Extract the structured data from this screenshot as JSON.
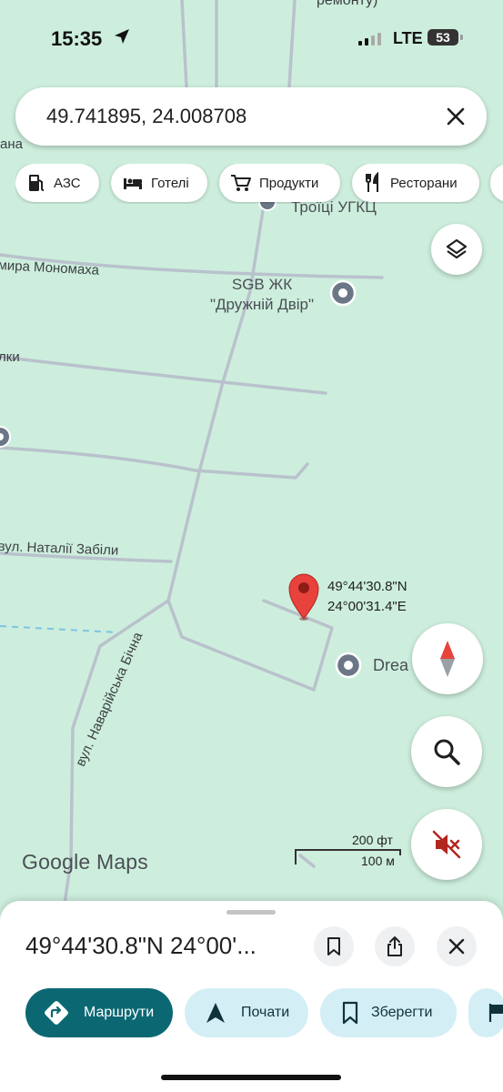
{
  "status_bar": {
    "time": "15:35",
    "network": "LTE",
    "battery": "53"
  },
  "search": {
    "query": "49.741895, 24.008708"
  },
  "chips": [
    {
      "label": "АЗС",
      "icon": "gas-station-icon"
    },
    {
      "label": "Готелі",
      "icon": "hotel-bed-icon"
    },
    {
      "label": "Продукти",
      "icon": "shopping-cart-icon"
    },
    {
      "label": "Ресторани",
      "icon": "fork-knife-icon"
    }
  ],
  "map": {
    "top_label": "ремонту)",
    "streets": {
      "left_edge": "ана",
      "monomakh": "мира Мономаха",
      "left2": "лки",
      "zabila": "вул. Наталії Забіли",
      "navariyska": "вул. Наварійська Бічна"
    },
    "church_label": "Троїці УГКЦ",
    "poi_residence": {
      "line1": "SGB ЖК",
      "line2": "\"Дружній Двір\""
    },
    "poi_dream": "Drea",
    "pin": {
      "lat": "49°44'30.8\"N",
      "lon": "24°00'31.4\"E"
    },
    "scale": {
      "imperial": "200 фт",
      "metric": "100 м"
    },
    "brand": "Google Maps"
  },
  "sheet": {
    "title": "49°44'30.8\"N 24°00'...",
    "actions": [
      {
        "label": "Маршрути",
        "icon": "directions-icon"
      },
      {
        "label": "Почати",
        "icon": "navigation-arrow-icon"
      },
      {
        "label": "Зберегти",
        "icon": "bookmark-icon"
      }
    ]
  },
  "colors": {
    "map_background": "#cdeedd",
    "road": "#b9c2cc",
    "pin": "#e8423d",
    "primary_button": "#0b6873",
    "secondary_button": "#d4eef5"
  }
}
